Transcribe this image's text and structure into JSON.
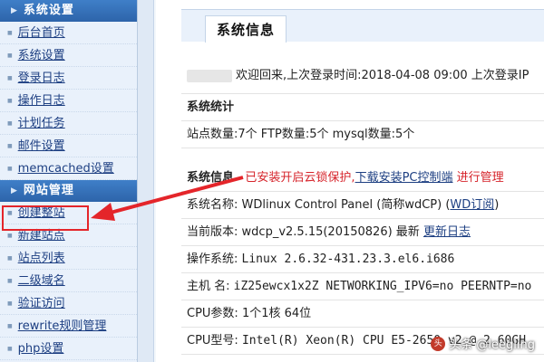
{
  "sidebar": {
    "section1_title": "系统设置",
    "section1_items": [
      "后台首页",
      "系统设置",
      "登录日志",
      "操作日志",
      "计划任务",
      "邮件设置",
      "memcached设置"
    ],
    "section2_title": "网站管理",
    "section2_items": [
      "创建整站",
      "新建站点",
      "站点列表",
      "二级域名",
      "验证访问",
      "rewrite规则管理",
      "php设置"
    ]
  },
  "main": {
    "tab_title": "系统信息",
    "welcome_text": "欢迎回来,上次登录时间:2018-04-08 09:00 上次登录IP",
    "stats_title": "系统统计",
    "stats_line": "站点数量:7个  FTP数量:5个  mysql数量:5个",
    "info_title": "系统信息",
    "cloudlock_text": "已安装开启云锁保护,",
    "cloudlock_link": "下载安装PC控制端",
    "cloudlock_tail": "进行管理",
    "sysname_label": "系统名称:",
    "sysname_value": "WDlinux Control Panel (简称wdCP) (",
    "sysname_link": "WD订阅",
    "sysname_tail": ")",
    "version_label": "当前版本:",
    "version_value": "wdcp_v2.5.15(20150826) 最新",
    "version_link": "更新日志",
    "os_label": "操作系统:",
    "os_value": "Linux 2.6.32-431.23.3.el6.i686",
    "host_label": "主机 名:",
    "host_value": "iZ25ewcx1x2Z NETWORKING_IPV6=no PEERNTP=no",
    "cpu_label": "CPU参数:",
    "cpu_value": "1个1核 64位",
    "cputype_label": "CPU型号:",
    "cputype_value": "Intel(R) Xeon(R) CPU E5-2650 v2 @ 2.60GH"
  },
  "watermark": {
    "logo": "头",
    "text": "头条 @leegling"
  },
  "colors": {
    "sidebar_header": "#2d64aa",
    "accent_red": "#d6242b",
    "link_blue": "#1d3f82"
  }
}
